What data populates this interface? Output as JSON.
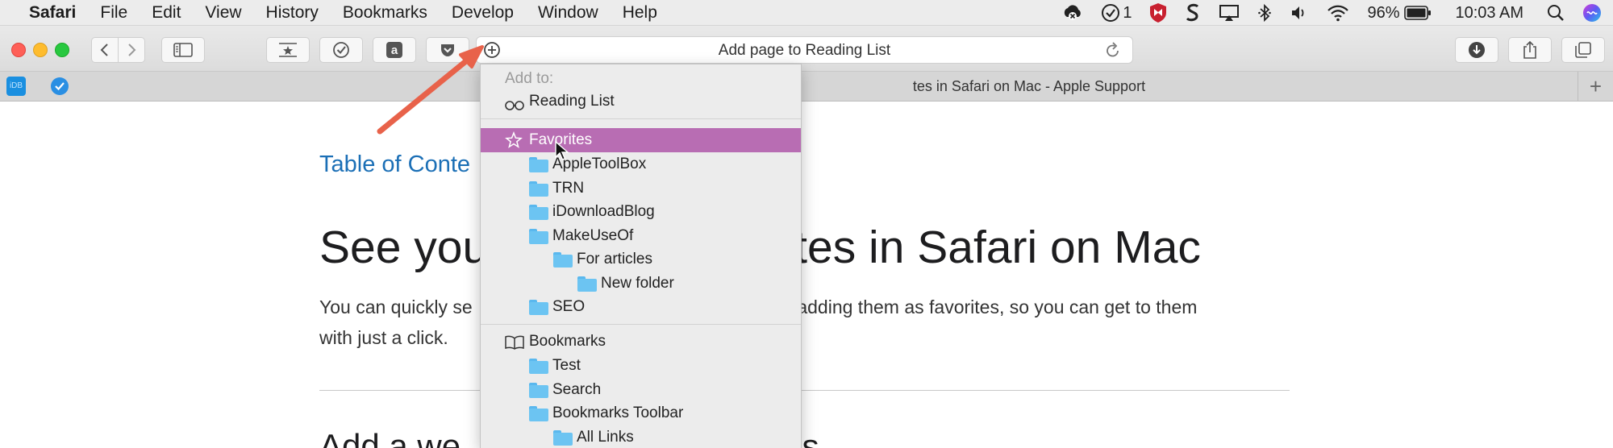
{
  "menubar": {
    "items": [
      "Safari",
      "File",
      "Edit",
      "View",
      "History",
      "Bookmarks",
      "Develop",
      "Window",
      "Help"
    ],
    "status": {
      "reminder_count": "1",
      "battery": "96%",
      "time": "10:03 AM"
    }
  },
  "toolbar": {
    "address_text": "Add page to Reading List"
  },
  "tabbar": {
    "pinned_tabs": [
      "iDB",
      "checkmark"
    ],
    "active_tab_title": "tes in Safari on Mac - Apple Support"
  },
  "page": {
    "toc_link": "Table of Conte",
    "heading_left": "See you",
    "heading_right": "tes in Safari on Mac",
    "para_line1_left": "You can quickly se",
    "para_line1_right": "by adding them as favorites, so you can get to them",
    "para_line2": "with just a click.",
    "subheading_left": "Add a we",
    "subheading_right": "es"
  },
  "dropdown": {
    "header": "Add to:",
    "reading_list": "Reading List",
    "favorites": "Favorites",
    "favorites_folders": [
      {
        "label": "AppleToolBox",
        "level": 1
      },
      {
        "label": "TRN",
        "level": 1
      },
      {
        "label": "iDownloadBlog",
        "level": 1
      },
      {
        "label": "MakeUseOf",
        "level": 1
      },
      {
        "label": "For articles",
        "level": 2
      },
      {
        "label": "New folder",
        "level": 3
      },
      {
        "label": "SEO",
        "level": 1
      }
    ],
    "bookmarks": "Bookmarks",
    "bookmarks_folders": [
      {
        "label": "Test",
        "level": 1
      },
      {
        "label": "Search",
        "level": 1
      },
      {
        "label": "Bookmarks Toolbar",
        "level": 1
      },
      {
        "label": "All Links",
        "level": 2
      }
    ]
  },
  "colors": {
    "selection": "#b86db3",
    "link": "#1b6fb6",
    "arrow": "#e8624a",
    "folder": "#6cc4f2"
  }
}
